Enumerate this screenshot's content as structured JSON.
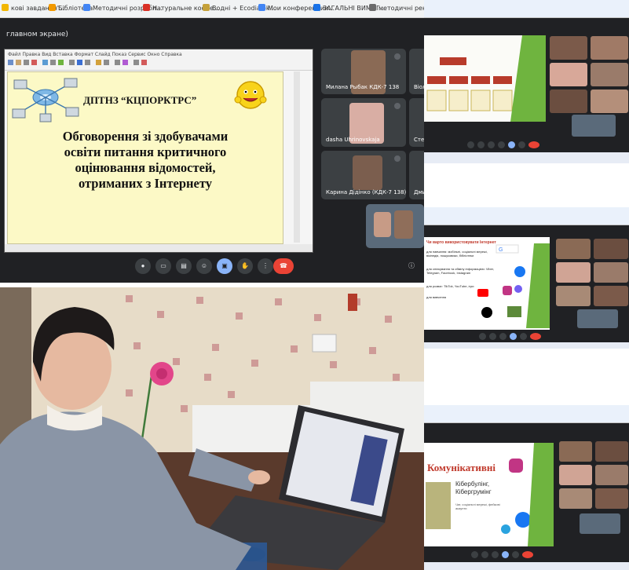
{
  "bookmarks": [
    {
      "label": "кові завдання'...",
      "color": "#f2b600"
    },
    {
      "label": "Бібліотека",
      "color": "#f29900"
    },
    {
      "label": "Методичні розробл...",
      "color": "#4285f4"
    },
    {
      "label": "Натуральне косме...",
      "color": "#d93025"
    },
    {
      "label": "Водні + Ecodialek...",
      "color": "#c5a13a"
    },
    {
      "label": "Мои конференции...",
      "color": "#4285f4"
    },
    {
      "label": "ЗАГАЛЬНІ ВИМОГ...",
      "color": "#1a73e8"
    },
    {
      "label": "методичні рекоме...",
      "color": "#6b6b6b"
    }
  ],
  "meet": {
    "presenting_title": "главном экране)",
    "slide": {
      "menu": "Файл  Правка  Вид  Вставка  Формат  Слайд  Показ  Сервис  Окно  Справка",
      "org_name": "ДПТНЗ “КЦПОРКТРС”",
      "title_lines": [
        "Обговорення зі здобувачами",
        "освіти питання критичного",
        "оцінювання відомостей,",
        "отриманих з Інтернету"
      ]
    },
    "participants": [
      {
        "name": "Милана Рыбак КДК-7 138"
      },
      {
        "name": "Віол"
      },
      {
        "name": "dasha Uhrinovskaja"
      },
      {
        "name": "Сте"
      },
      {
        "name": "Карина Дідінко (КДК-7 138)"
      },
      {
        "name": "Дми"
      },
      {
        "name": ""
      }
    ],
    "controls": [
      "mic",
      "camera",
      "captions",
      "emoji",
      "present",
      "hand",
      "more",
      "end-call"
    ],
    "info_icon": "info"
  },
  "shot2": {
    "heading": "Чи варто використовувати Інтернет",
    "items": [
      "для навчання: мобільні, соціальні мережі, вікіпедія, пошуковики, бібліотеки",
      "для спілкування та обміну інформацією: Viber, Telegram, Facebook, Instagram",
      "для розваг: TikTok, YouTube, ігри",
      "для вивчення"
    ]
  },
  "shot3": {
    "heading": "Комунікативні",
    "subtitle": "Кібербулінг,\nКібергрумінг",
    "note": "Чат, соціальні мережі, фейкові акаунти"
  },
  "colors": {
    "meet_bg": "#202124",
    "slide_bg": "#fcf9c6",
    "end_call": "#ea4335",
    "present_active": "#8ab4f8",
    "green_accent": "#6fb43f"
  }
}
